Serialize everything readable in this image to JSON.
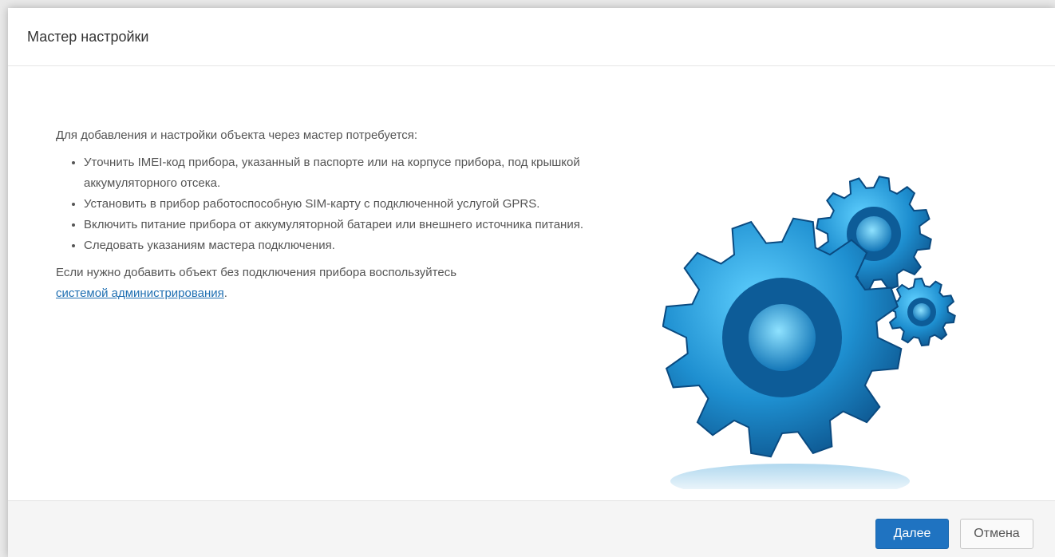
{
  "dialog": {
    "title": "Мастер настройки",
    "intro": "Для добавления и настройки объекта через мастер потребуется:",
    "requirements": [
      "Уточнить IMEI-код прибора, указанный в паспорте или на корпусе прибора, под крышкой аккумуляторного отсека.",
      "Установить в прибор работоспособную SIM-карту с подключенной услугой GPRS.",
      "Включить питание прибора от аккумуляторной батареи или внешнего источника питания.",
      "Следовать указаниям мастера подключения."
    ],
    "note_prefix": "Если нужно добавить объект без подключения прибора воспользуйтесь",
    "note_link": "системой администрирования",
    "note_suffix": "."
  },
  "illustration": {
    "icon": "gears-icon"
  },
  "footer": {
    "next_label": "Далее",
    "cancel_label": "Отмена"
  },
  "colors": {
    "primary": "#1f73c1",
    "link": "#1f6fb2",
    "gear": "#1e8fd0"
  }
}
